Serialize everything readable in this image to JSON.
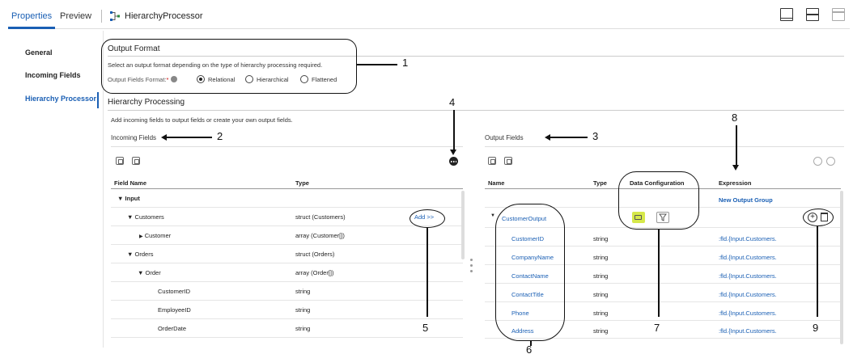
{
  "header": {
    "tabs": [
      "Properties",
      "Preview"
    ],
    "object_title": "HierarchyProcessor"
  },
  "nav": {
    "items": [
      "General",
      "Incoming Fields",
      "Hierarchy Processor"
    ]
  },
  "output_format": {
    "title": "Output Format",
    "description": "Select an output format depending on the type of hierarchy processing required.",
    "field_label": "Output Fields Format:",
    "required_mark": "*",
    "options": [
      "Relational",
      "Hierarchical",
      "Flattened"
    ],
    "selected": "Relational"
  },
  "hierarchy_processing": {
    "title": "Hierarchy Processing",
    "description": "Add incoming fields to output fields or create your own output fields."
  },
  "incoming": {
    "title": "Incoming Fields",
    "columns": [
      "Field Name",
      "Type"
    ],
    "rows": [
      {
        "name": "Input",
        "type": "",
        "toggle": "▼"
      },
      {
        "name": "Customers",
        "type": "struct (Customers)",
        "toggle": "▼"
      },
      {
        "name": "Customer",
        "type": "array (Customer[])",
        "toggle": "▶"
      },
      {
        "name": "Orders",
        "type": "struct (Orders)",
        "toggle": "▼"
      },
      {
        "name": "Order",
        "type": "array (Order[])",
        "toggle": "▼"
      },
      {
        "name": "CustomerID",
        "type": "string",
        "toggle": ""
      },
      {
        "name": "EmployeeID",
        "type": "string",
        "toggle": ""
      },
      {
        "name": "OrderDate",
        "type": "string",
        "toggle": ""
      }
    ],
    "add_label": "Add >>"
  },
  "output": {
    "title": "Output Fields",
    "columns": [
      "Name",
      "Type",
      "Data Configuration",
      "Expression"
    ],
    "new_group_label": "New Output Group",
    "group_name": "CustomerOutput",
    "rows": [
      {
        "name": "CustomerID",
        "type": "string",
        "expr": ":fld.{Input.Customers."
      },
      {
        "name": "CompanyName",
        "type": "string",
        "expr": ":fld.{Input.Customers."
      },
      {
        "name": "ContactName",
        "type": "string",
        "expr": ":fld.{Input.Customers."
      },
      {
        "name": "ContactTitle",
        "type": "string",
        "expr": ":fld.{Input.Customers."
      },
      {
        "name": "Phone",
        "type": "string",
        "expr": ":fld.{Input.Customers."
      },
      {
        "name": "Address",
        "type": "string",
        "expr": ":fld.{Input.Customers."
      }
    ]
  },
  "callouts": [
    "1",
    "2",
    "3",
    "4",
    "5",
    "6",
    "7",
    "8",
    "9"
  ],
  "colors": {
    "accent": "#1a5fb4",
    "config_button": "#d6e84a"
  }
}
